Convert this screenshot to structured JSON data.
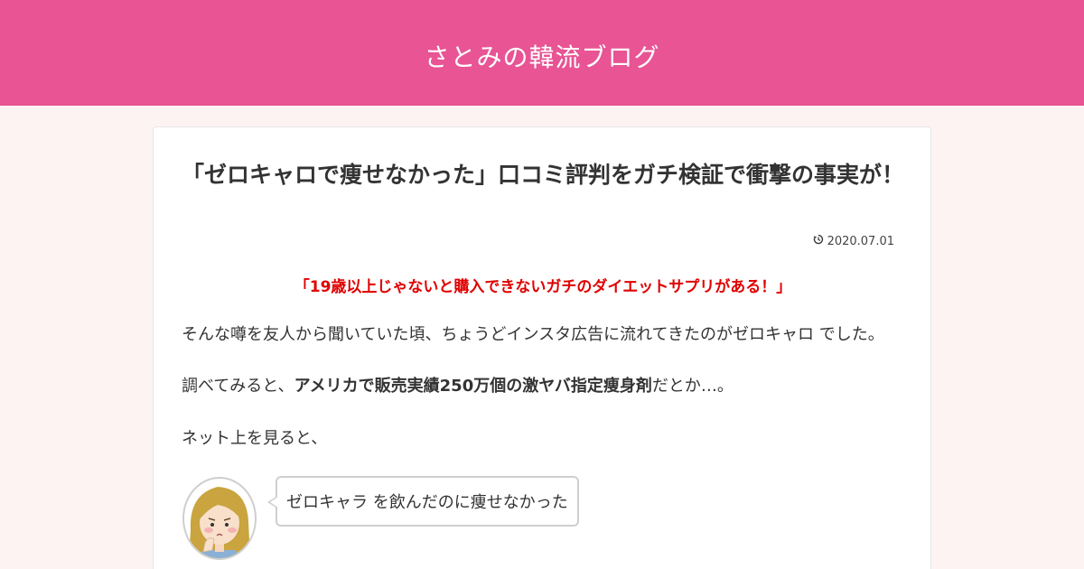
{
  "header": {
    "site_title": "さとみの韓流ブログ",
    "background_color": "#e85494"
  },
  "article": {
    "title": "「ゼロキャロで痩せなかった」口コミ評判をガチ検証で衝撃の事実が！",
    "date_icon": "update-clock-icon",
    "date": "2020.07.01",
    "lead_quote": "「19歳以上じゃないと購入できないガチのダイエットサプリがある！」",
    "paragraph1": "そんな噂を友人から聞いていた頃、ちょうどインスタ広告に流れてきたのがゼロキャロ でした。",
    "paragraph2": {
      "prefix": "調べてみると、",
      "strong": "アメリカで販売実績250万個の激ヤバ指定痩身剤",
      "suffix": "だとか…。"
    },
    "paragraph3": "ネット上を見ると、",
    "speech_bubble": {
      "avatar_icon": "worried-woman-avatar",
      "text": "ゼロキャラ を飲んだのに痩せなかった"
    }
  },
  "colors": {
    "accent": "#e85494",
    "page_background": "#fdf3f2",
    "highlight_red": "#e00000"
  }
}
